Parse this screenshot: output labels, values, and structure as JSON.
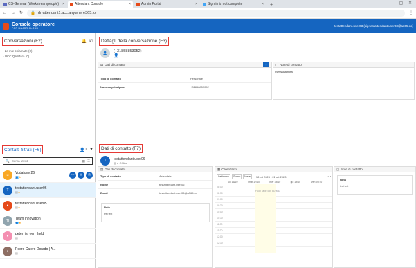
{
  "browser": {
    "tabs": [
      {
        "label": "CS-General (Workstreampeople)",
        "active": false
      },
      {
        "label": "Attendant Console",
        "active": true
      },
      {
        "label": "Admin Portal",
        "active": false
      },
      {
        "label": "Sign in is not complete",
        "active": false
      }
    ],
    "new_tab": "+",
    "url": "dr-attendant1.acc.anywhere365.io"
  },
  "brand": {
    "title": "Console operatore",
    "subtitle": "FOR MAJOR CLOUD",
    "user": "testattendant.user03 (sip:testattendant.user03@a365.co)"
  },
  "left": {
    "conversations_title": "Conversazioni (F2)",
    "tree": [
      "Le mie chiamate (0)",
      "UCC QA Mara (0)"
    ],
    "filtered_title": "Contatti filtrati",
    "filtered_key": "(F6)",
    "search_placeholder": "Cerca utenti",
    "contacts": [
      {
        "name": "Vodafone 26",
        "initials": "",
        "color": "#f9a825",
        "selected": false
      },
      {
        "name": "testattendant.user06",
        "initials": "T",
        "color": "#1565c0",
        "selected": true
      },
      {
        "name": "testattendant.user05",
        "initials": "",
        "color": "#e64a19",
        "selected": false
      },
      {
        "name": "Team Innovation",
        "initials": "TI",
        "color": "#90a4ae",
        "selected": false
      },
      {
        "name": "peter_is_een_held",
        "initials": "",
        "color": "#f48fb1",
        "selected": false
      },
      {
        "name": "Pedro Calero Dorado | A...",
        "initials": "",
        "color": "#8d6e63",
        "selected": false
      }
    ]
  },
  "conv": {
    "title": "Dettagli della conversazione (F3)",
    "number": "(+31858853052)",
    "contact_data_title": "Dati di contatto",
    "notes_title": "Note di contatto",
    "notes_body": "Nessuna nota",
    "rows": [
      {
        "k": "Tipo di contatto",
        "v": "Personale"
      },
      {
        "k": "Numero principale",
        "v": "+31858853052"
      }
    ]
  },
  "contact": {
    "title": "Dati di contatto (F7)",
    "name": "testattendant.user06",
    "status": "Offline",
    "contact_data_title": "Dati di contatto",
    "rows": [
      {
        "k": "Tipo di contatto",
        "v": "Aziendale"
      },
      {
        "k": "Nome",
        "v": "testattendant.user06"
      },
      {
        "k": "Email",
        "v": "testattendant.user06@a365.co"
      }
    ],
    "note_label": "Nota",
    "note_text": "test text",
    "calendar_title": "Calendario",
    "calendar_range": "18 ott 2023 - 22 ott 2023",
    "calendar_buttons": [
      "Settimana",
      "Giorno",
      "Mese"
    ],
    "calendar_days": [
      "lun 16/10",
      "mar 17/10",
      "mer 18/10",
      "gio 19/10",
      "ven 20/10"
    ],
    "calendar_times": [
      "08:00",
      "08:30",
      "09:00",
      "09:30",
      "10:00",
      "10:30",
      "11:00",
      "11:30",
      "12:00",
      "12:30"
    ],
    "calendar_event": "Fuori sede con Bureau",
    "notes_title": "Note di contatto",
    "notes_label": "Nota",
    "notes_text": "test text"
  }
}
